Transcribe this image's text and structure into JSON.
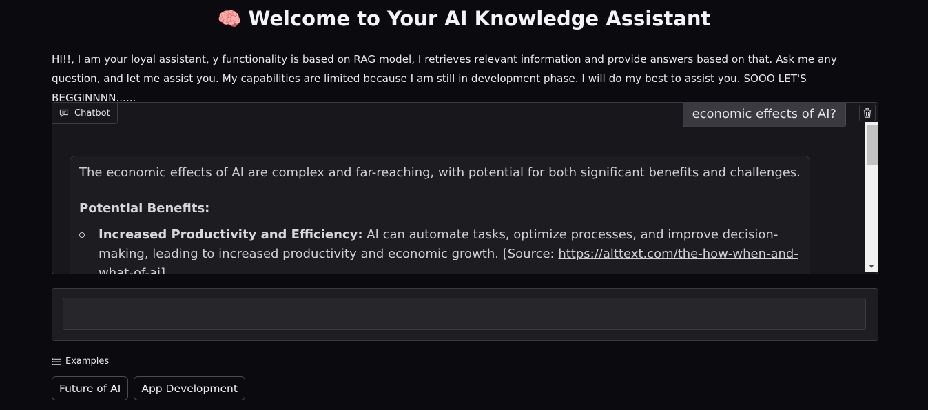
{
  "header": {
    "emoji": "🧠",
    "title": "Welcome to Your AI Knowledge Assistant"
  },
  "intro_text": "HI!!, I am your loyal assistant, y functionality is based on RAG model, I retrieves relevant information and provide answers based on that. Ask me any question, and let me assist you. My capabilities are limited because I am still in development phase. I will do my best to assist you. SOOO LET'S BEGGINNNN......",
  "chatbot": {
    "label": "Chatbot",
    "user_message": "economic effects of AI?",
    "bot_message": {
      "intro": "The economic effects of AI are complex and far-reaching, with potential for both significant benefits and challenges.",
      "heading": "Potential Benefits:",
      "bullets": [
        {
          "bold": "Increased Productivity and Efficiency:",
          "text": " AI can automate tasks, optimize processes, and improve decision-making, leading to increased productivity and economic growth. [Source: ",
          "link": "https://alttext.com/the-how-when-and-what-of-ai",
          "suffix": "]"
        }
      ]
    }
  },
  "input": {
    "value": "",
    "placeholder": ""
  },
  "examples": {
    "label": "Examples",
    "items": [
      "Future of AI",
      "App Development"
    ]
  }
}
